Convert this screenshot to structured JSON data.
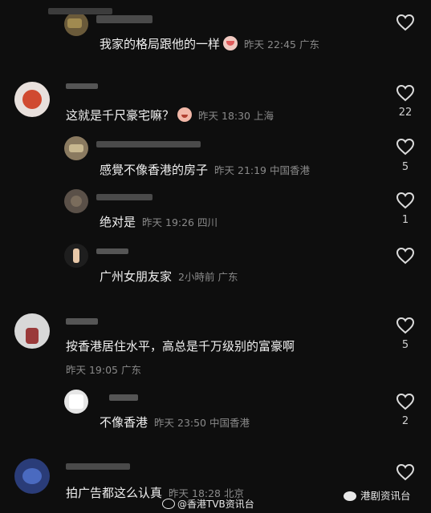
{
  "colors": {
    "background": "#0e0e0e",
    "text": "#f0f0f0",
    "meta": "#8a8a8a",
    "count": "#cfcfcf"
  },
  "comments": [
    {
      "text": "我家的格局跟他的一样",
      "emoji": "crying-face-emoji",
      "time": "昨天 22:45 广东",
      "likes": ""
    },
    {
      "text": "这就是千尺豪宅嘛？",
      "emoji": "smiling-face-emoji",
      "time": "昨天 18:30 上海",
      "likes": "22"
    },
    {
      "text": "感覺不像香港的房子",
      "time": "昨天 21:19 中国香港",
      "likes": "5"
    },
    {
      "text": "绝对是",
      "time": "昨天 19:26 四川",
      "likes": "1"
    },
    {
      "text": "广州女朋友家",
      "time": "2小時前 广东",
      "likes": ""
    },
    {
      "text": "按香港居住水平，高总是千万级别的富豪啊",
      "time": "昨天 19:05 广东",
      "likes": "5"
    },
    {
      "text": "不像香港",
      "time": "昨天 23:50 中国香港",
      "likes": "2"
    },
    {
      "text": "拍广告都这么认真",
      "time": "昨天 18:28 北京",
      "likes": ""
    }
  ],
  "watermark": {
    "weibo": "@香港TVB资讯台",
    "wechat": "港剧资讯台"
  }
}
